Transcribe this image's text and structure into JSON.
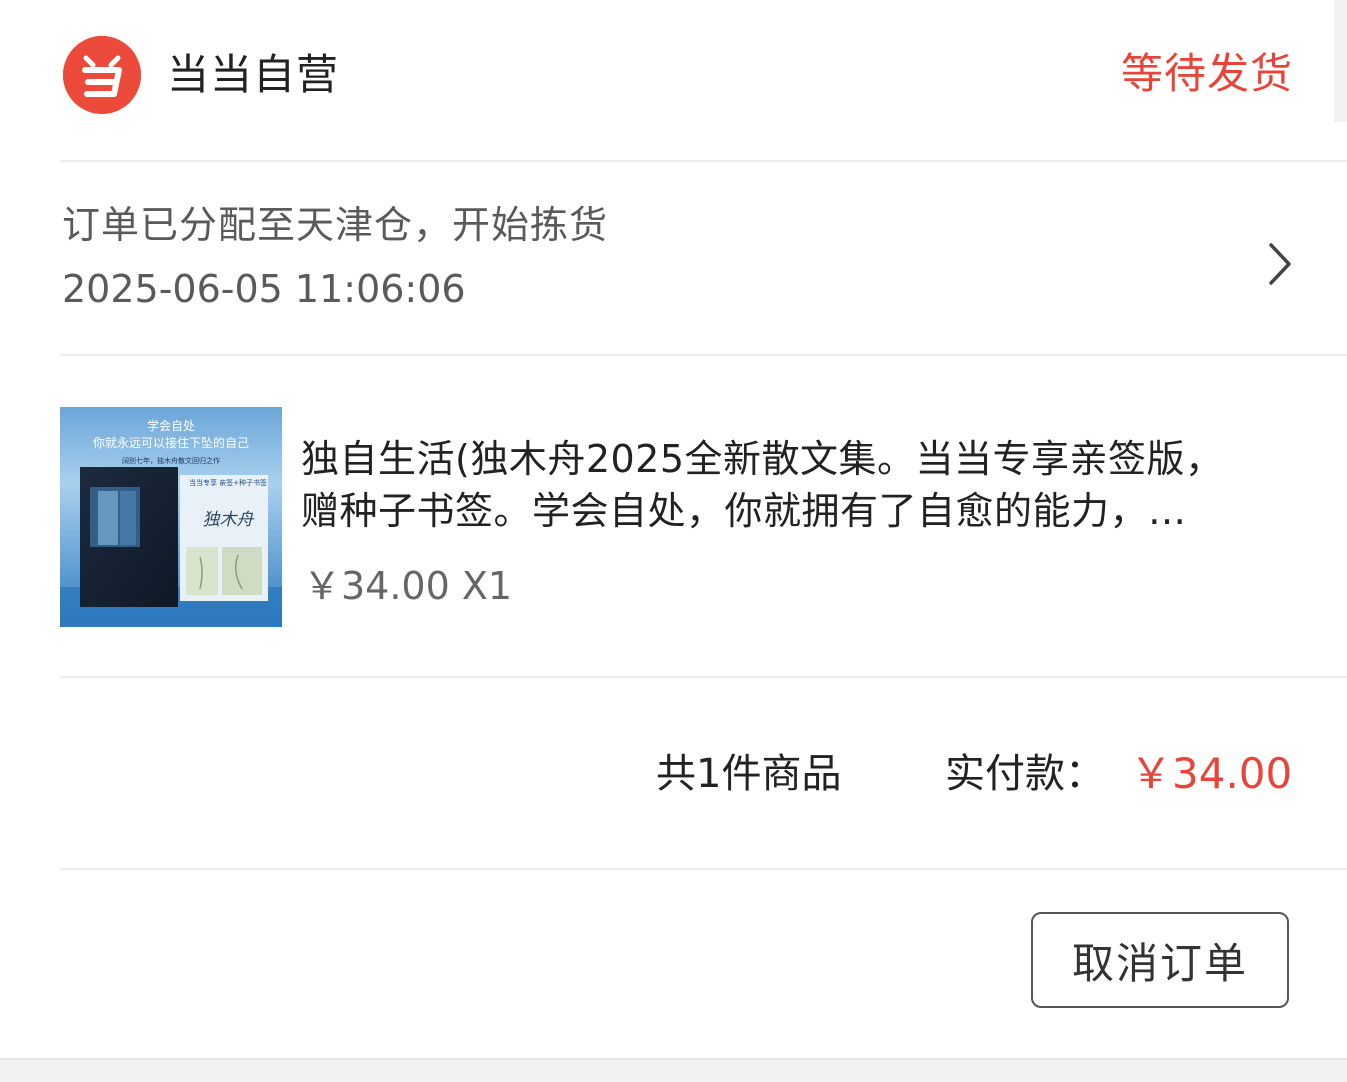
{
  "header": {
    "logo_icon": "dangdang-logo-icon",
    "shop_name": "当当自营",
    "order_status": "等待发货",
    "status_color": "#e8453a"
  },
  "logistics": {
    "message": "订单已分配至天津仓，开始拣货",
    "time": "2025-06-05 11:06:06",
    "arrow_icon": "chevron-right-icon"
  },
  "product": {
    "cover": {
      "line1": "学会自处",
      "line2": "你就永远可以接住下坠的自己",
      "line3": "阔别七年，独木舟散文回归之作",
      "badge": "当当专享 亲签+种子书签",
      "signature": "独木舟"
    },
    "title_line1": "独自生活(独木舟2025全新散文集。当当专享亲签版，",
    "title_line2": "赠种子书签。学会自处，你就拥有了自愈的能力，…",
    "price_qty": "￥34.00 X1"
  },
  "summary": {
    "count_text": "共1件商品",
    "paid_label": "实付款：",
    "paid_amount": "￥34.00"
  },
  "actions": {
    "cancel_label": "取消订单"
  }
}
